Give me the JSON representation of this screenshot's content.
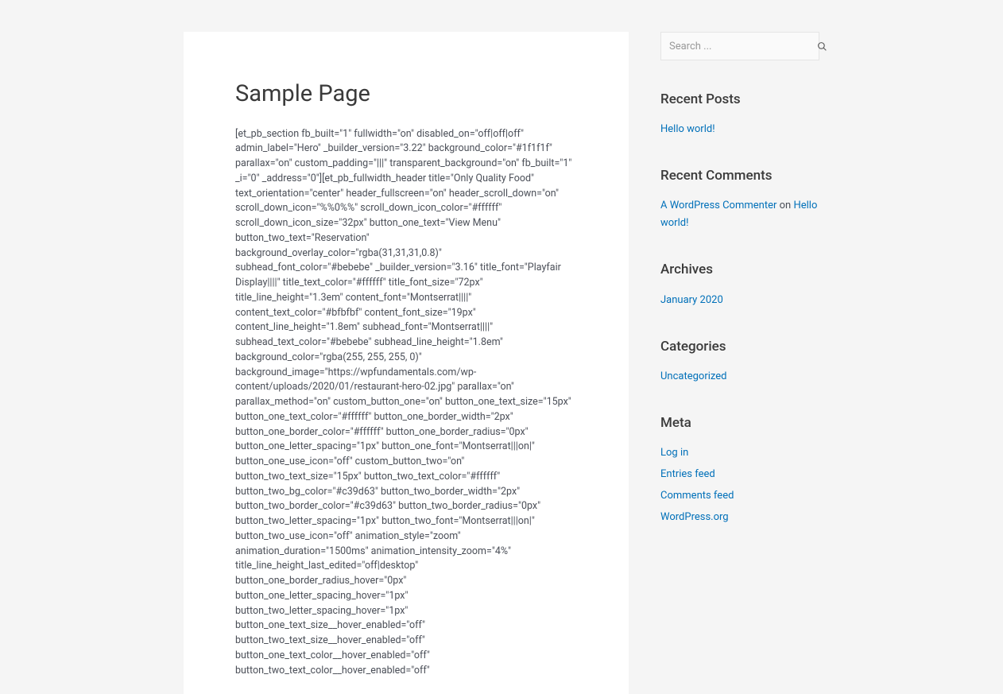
{
  "page": {
    "title": "Sample Page",
    "body": "[et_pb_section fb_built=\"1\" fullwidth=\"on\" disabled_on=\"off|off|off\" admin_label=\"Hero\" _builder_version=\"3.22\" background_color=\"#1f1f1f\" parallax=\"on\" custom_padding=\"|||\" transparent_background=\"on\" fb_built=\"1\" _i=\"0\" _address=\"0\"][et_pb_fullwidth_header title=\"Only Quality Food\" text_orientation=\"center\" header_fullscreen=\"on\" header_scroll_down=\"on\" scroll_down_icon=\"%%0%%\" scroll_down_icon_color=\"#ffffff\" scroll_down_icon_size=\"32px\" button_one_text=\"View Menu\" button_two_text=\"Reservation\" background_overlay_color=\"rgba(31,31,31,0.8)\" subhead_font_color=\"#bebebe\" _builder_version=\"3.16\" title_font=\"Playfair Display||||\" title_text_color=\"#ffffff\" title_font_size=\"72px\" title_line_height=\"1.3em\" content_font=\"Montserrat||||\" content_text_color=\"#bfbfbf\" content_font_size=\"19px\" content_line_height=\"1.8em\" subhead_font=\"Montserrat||||\" subhead_text_color=\"#bebebe\" subhead_line_height=\"1.8em\" background_color=\"rgba(255, 255, 255, 0)\" background_image=\"https://wpfundamentals.com/wp-content/uploads/2020/01/restaurant-hero-02.jpg\" parallax=\"on\" parallax_method=\"on\" custom_button_one=\"on\" button_one_text_size=\"15px\" button_one_text_color=\"#ffffff\" button_one_border_width=\"2px\" button_one_border_color=\"#ffffff\" button_one_border_radius=\"0px\" button_one_letter_spacing=\"1px\" button_one_font=\"Montserrat|||on|\" button_one_use_icon=\"off\" custom_button_two=\"on\" button_two_text_size=\"15px\" button_two_text_color=\"#ffffff\" button_two_bg_color=\"#c39d63\" button_two_border_width=\"2px\" button_two_border_color=\"#c39d63\" button_two_border_radius=\"0px\" button_two_letter_spacing=\"1px\" button_two_font=\"Montserrat|||on|\" button_two_use_icon=\"off\" animation_style=\"zoom\" animation_duration=\"1500ms\" animation_intensity_zoom=\"4%\" title_line_height_last_edited=\"off|desktop\" button_one_border_radius_hover=\"0px\" button_one_letter_spacing_hover=\"1px\" button_two_letter_spacing_hover=\"1px\" button_one_text_size__hover_enabled=\"off\" button_two_text_size__hover_enabled=\"off\" button_one_text_color__hover_enabled=\"off\" button_two_text_color__hover_enabled=\"off\""
  },
  "search": {
    "placeholder": "Search ..."
  },
  "widgets": {
    "recentPosts": {
      "title": "Recent Posts",
      "items": [
        "Hello world!"
      ]
    },
    "recentComments": {
      "title": "Recent Comments",
      "items": [
        {
          "author": "A WordPress Commenter",
          "on": " on ",
          "post": "Hello world!"
        }
      ]
    },
    "archives": {
      "title": "Archives",
      "items": [
        "January 2020"
      ]
    },
    "categories": {
      "title": "Categories",
      "items": [
        "Uncategorized"
      ]
    },
    "meta": {
      "title": "Meta",
      "items": [
        "Log in",
        "Entries feed",
        "Comments feed",
        "WordPress.org"
      ]
    }
  }
}
